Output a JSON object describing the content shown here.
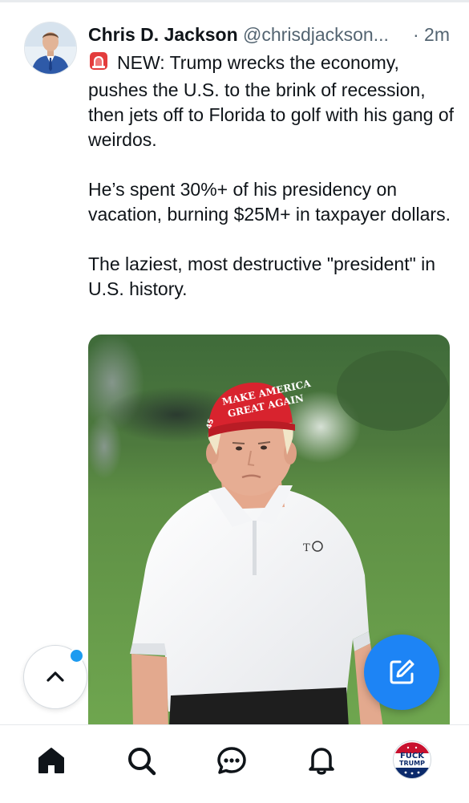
{
  "post": {
    "author": {
      "name": "Chris D. Jackson",
      "handle": "@chrisdjackson...",
      "avatar_icon": "profile-photo"
    },
    "time": "· 2m",
    "text": {
      "para1": "NEW: Trump wrecks the economy, pushes the U.S. to the brink of recession, then jets off to Florida to golf with his gang of weirdos.",
      "para2": "He’s spent 30%+ of his presidency on vacation, burning $25M+ in taxpayer dollars.",
      "para3": "The laziest, most destructive \"president\" in U.S. history."
    },
    "emoji_icon": "rotating-light-icon",
    "media": {
      "hat_line1": "MAKE AMERICA",
      "hat_line2": "GREAT AGAIN",
      "hat_side": "45"
    }
  },
  "controls": {
    "scroll_top_icon": "chevron-up-icon",
    "compose_icon": "compose-icon",
    "accent_color": "#1d84f5",
    "dot_color": "#1d9bf0"
  },
  "bottom_nav": {
    "items": [
      {
        "icon": "home-icon"
      },
      {
        "icon": "search-icon"
      },
      {
        "icon": "chat-icon"
      },
      {
        "icon": "bell-icon"
      },
      {
        "icon": "profile-avatar"
      }
    ],
    "profile_badge": {
      "line1": "FUCK",
      "line2": "TRUMP"
    }
  }
}
